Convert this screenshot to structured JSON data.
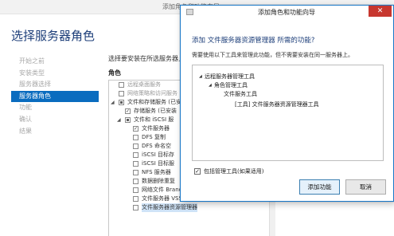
{
  "background": {
    "title": "添加角色和功能向导",
    "heading": "选择服务器角色",
    "nav": [
      "开始之前",
      "安装类型",
      "服务器选择",
      "服务器角色",
      "功能",
      "确认",
      "结果"
    ],
    "active_nav": 3,
    "description": "选择要安装在所选服务器上的一个或多个角色。",
    "column_header": "角色",
    "tree": [
      {
        "label": "远程桌面服务",
        "checkbox": "none",
        "expander": "",
        "indent": 1
      },
      {
        "label": "网络策略和访问服务",
        "checkbox": "none",
        "expander": "",
        "indent": 1
      },
      {
        "label": "文件和存储服务 (已安装",
        "checkbox": "mixed",
        "expander": "◢",
        "indent": 1
      },
      {
        "label": "存储服务 (已安装",
        "checkbox": "checked",
        "expander": "",
        "indent": 2
      },
      {
        "label": "文件和 iSCSI 服",
        "checkbox": "mixed",
        "expander": "◢",
        "indent": 2
      },
      {
        "label": "文件服务器",
        "checkbox": "checked",
        "expander": "",
        "indent": 3
      },
      {
        "label": "DFS 复制",
        "checkbox": "none",
        "expander": "",
        "indent": 3
      },
      {
        "label": "DFS 命名空",
        "checkbox": "none",
        "expander": "",
        "indent": 3
      },
      {
        "label": "iSCSI 目标存",
        "checkbox": "none",
        "expander": "",
        "indent": 3
      },
      {
        "label": "iSCSI 目标服",
        "checkbox": "none",
        "expander": "",
        "indent": 3
      },
      {
        "label": "NFS 服务器",
        "checkbox": "none",
        "expander": "",
        "indent": 3
      },
      {
        "label": "数据删除重复",
        "checkbox": "none",
        "expander": "",
        "indent": 3
      },
      {
        "label": "网络文件 BranchCache",
        "checkbox": "none",
        "expander": "",
        "indent": 3
      },
      {
        "label": "文件服务器 VSS 代理服务",
        "checkbox": "none",
        "expander": "",
        "indent": 3
      },
      {
        "label": "文件服务器资源管理器",
        "checkbox": "none",
        "expander": "",
        "indent": 3,
        "highlight": true
      }
    ]
  },
  "dialog": {
    "title": "添加角色和功能向导",
    "close_glyph": "✕",
    "heading": "添加 文件服务器资源管理器 所需的功能?",
    "description": "需要使用以下工具来管理此功能，但不需要安装在同一服务器上。",
    "features": [
      {
        "label": "远程服务器管理工具",
        "indent": 0,
        "expander": "◢"
      },
      {
        "label": "角色管理工具",
        "indent": 1,
        "expander": "◢"
      },
      {
        "label": "文件服务工具",
        "indent": 2,
        "expander": ""
      },
      {
        "label": "[工具] 文件服务器资源管理器工具",
        "indent": 3,
        "expander": ""
      }
    ],
    "include_tools": {
      "label": "包括管理工具(如果适用)",
      "checked": true,
      "check_glyph": "✓"
    },
    "add_button": "添加功能",
    "cancel_button": "取消"
  }
}
